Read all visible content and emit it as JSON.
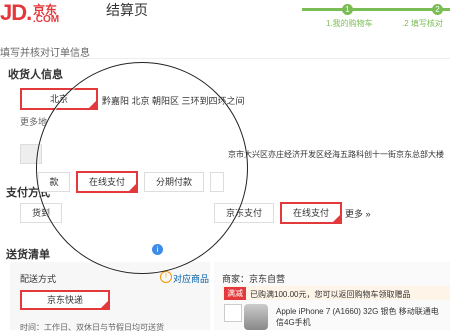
{
  "header": {
    "logo_letters": "JD.",
    "logo_cn": "京东",
    "logo_com": ".COM",
    "page_title": "结算页",
    "steps": [
      {
        "num": "1",
        "label": "1.我的购物车"
      },
      {
        "num": "2",
        "label": ".2 填写核对"
      }
    ]
  },
  "subheading": "填写并核对订单信息",
  "receiver": {
    "title": "收货人信息",
    "selected_city": "北京",
    "address_preview": "黔嘉阳  北京 朝阳区 三环到四环之间",
    "more": "更多地",
    "detail": "京市大兴区亦庄经济开发区经海五路科创十一街京东总部大楼"
  },
  "payment": {
    "title": "支付方式",
    "options_top": [
      "款",
      "在线支付",
      "分期付款"
    ],
    "options_bottom": [
      "货到",
      "京东支付",
      "在线支付"
    ],
    "more": "更多 »"
  },
  "delivery": {
    "title": "送货清单",
    "info_icon": "i",
    "method_label": "配送方式",
    "method_value": "京东快递",
    "ship_product_label": "对应商品",
    "time_label": "时间：工作日、双休日与节假日均可送货",
    "seller_label": "商家：京东自营",
    "promo_tag": "满减",
    "promo_text": "已购满100.00元，您可以返回购物车领取赠品",
    "product_name": "Apple iPhone 7 (A1660) 32G 银色 移动联通电信4G手机"
  },
  "colors": {
    "brand": "#e4393c",
    "step_green": "#7abd54"
  }
}
